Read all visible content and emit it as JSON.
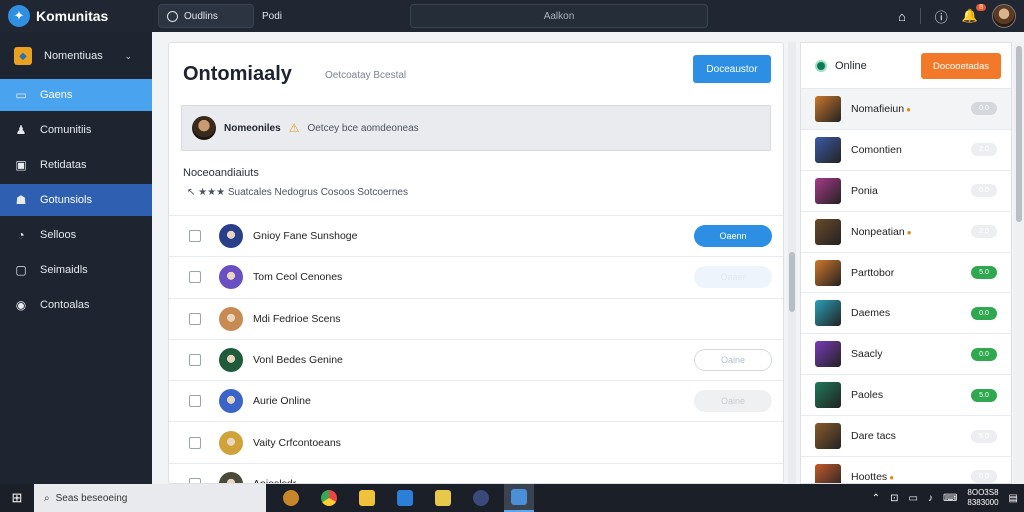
{
  "topbar": {
    "brand": "Komunitas",
    "search_label": "Oudlins",
    "extra": "Podi",
    "center": "Aalkon",
    "notif_count": "8"
  },
  "sidebar": {
    "items": [
      {
        "label": "Nomentiuas",
        "icon": "cube-icon"
      },
      {
        "label": "Gaens",
        "icon": "image-icon"
      },
      {
        "label": "Comunitiis",
        "icon": "person-icon"
      },
      {
        "label": "Retidatas",
        "icon": "briefcase-icon"
      },
      {
        "label": "Gotunsiols",
        "icon": "people-icon"
      },
      {
        "label": "Selloos",
        "icon": "chat-icon"
      },
      {
        "label": "Seimaidls",
        "icon": "tablet-icon"
      },
      {
        "label": "Contoalas",
        "icon": "gear-icon"
      }
    ]
  },
  "main": {
    "title": "Ontomiaaly",
    "subtitle": "Oetcoatay Bcestal",
    "button": "Doceaustor",
    "banner_name": "Nomeoniles",
    "banner_text": "Oetcey bce aomdeoneas",
    "list_heading": "Noceoandiaiuts",
    "list_sub": "Suatcales Nedogrus Cosoos Sotcoernes",
    "list_sub_stars": "★★★",
    "rows": [
      {
        "name": "Gnioy Fane Sunshoge",
        "button": "Oaenn",
        "style": "primary",
        "avatar": "#2a3f8a"
      },
      {
        "name": "Tom Ceol Cenones",
        "button": "Oaaer",
        "style": "faint",
        "avatar": "#6a4fc2"
      },
      {
        "name": "Mdi Fedrioe Scens",
        "button": "",
        "style": "none",
        "avatar": "#c78a52"
      },
      {
        "name": "Vonl Bedes Genine",
        "button": "Oaine",
        "style": "outline",
        "avatar": "#1f5a3a"
      },
      {
        "name": "Aurie Online",
        "button": "Oaine",
        "style": "soft",
        "avatar": "#3a64c8"
      },
      {
        "name": "Vaity Crfcontoeans",
        "button": "",
        "style": "none",
        "avatar": "#d0a23a"
      },
      {
        "name": "Anioslsdr",
        "button": "",
        "style": "none",
        "avatar": "#4a4a3a"
      }
    ]
  },
  "right": {
    "title": "Online",
    "button": "Docooetadas",
    "items": [
      {
        "name": "Nomafieiun",
        "star": true,
        "pill": "grey",
        "pill_text": "0.0",
        "color": "#c9772a"
      },
      {
        "name": "Comontien",
        "star": false,
        "pill": "light",
        "pill_text": "2.0",
        "color": "#3b5ba8"
      },
      {
        "name": "Ponia",
        "star": false,
        "pill": "light",
        "pill_text": "0.0",
        "color": "#a83a8a"
      },
      {
        "name": "Nonpeatian",
        "star": true,
        "pill": "light",
        "pill_text": "2.0",
        "color": "#6a4a2a"
      },
      {
        "name": "Parttobor",
        "star": false,
        "pill": "green",
        "pill_text": "5.0",
        "color": "#d1782a"
      },
      {
        "name": "Daemes",
        "star": false,
        "pill": "green",
        "pill_text": "0.0",
        "color": "#2aa0b8"
      },
      {
        "name": "Saacly",
        "star": false,
        "pill": "green",
        "pill_text": "0.0",
        "color": "#7a3ab8"
      },
      {
        "name": "Paoles",
        "star": false,
        "pill": "green",
        "pill_text": "5.0",
        "color": "#1f7a5a"
      },
      {
        "name": "Dare tacs",
        "star": false,
        "pill": "light",
        "pill_text": "5.0",
        "color": "#8a5a2a"
      },
      {
        "name": "Hoottes",
        "star": true,
        "pill": "light",
        "pill_text": "0.0",
        "color": "#c45a2a"
      }
    ]
  },
  "taskbar": {
    "search": "Seas beseoeing",
    "time": "8OO3S8",
    "date": "8383000"
  }
}
